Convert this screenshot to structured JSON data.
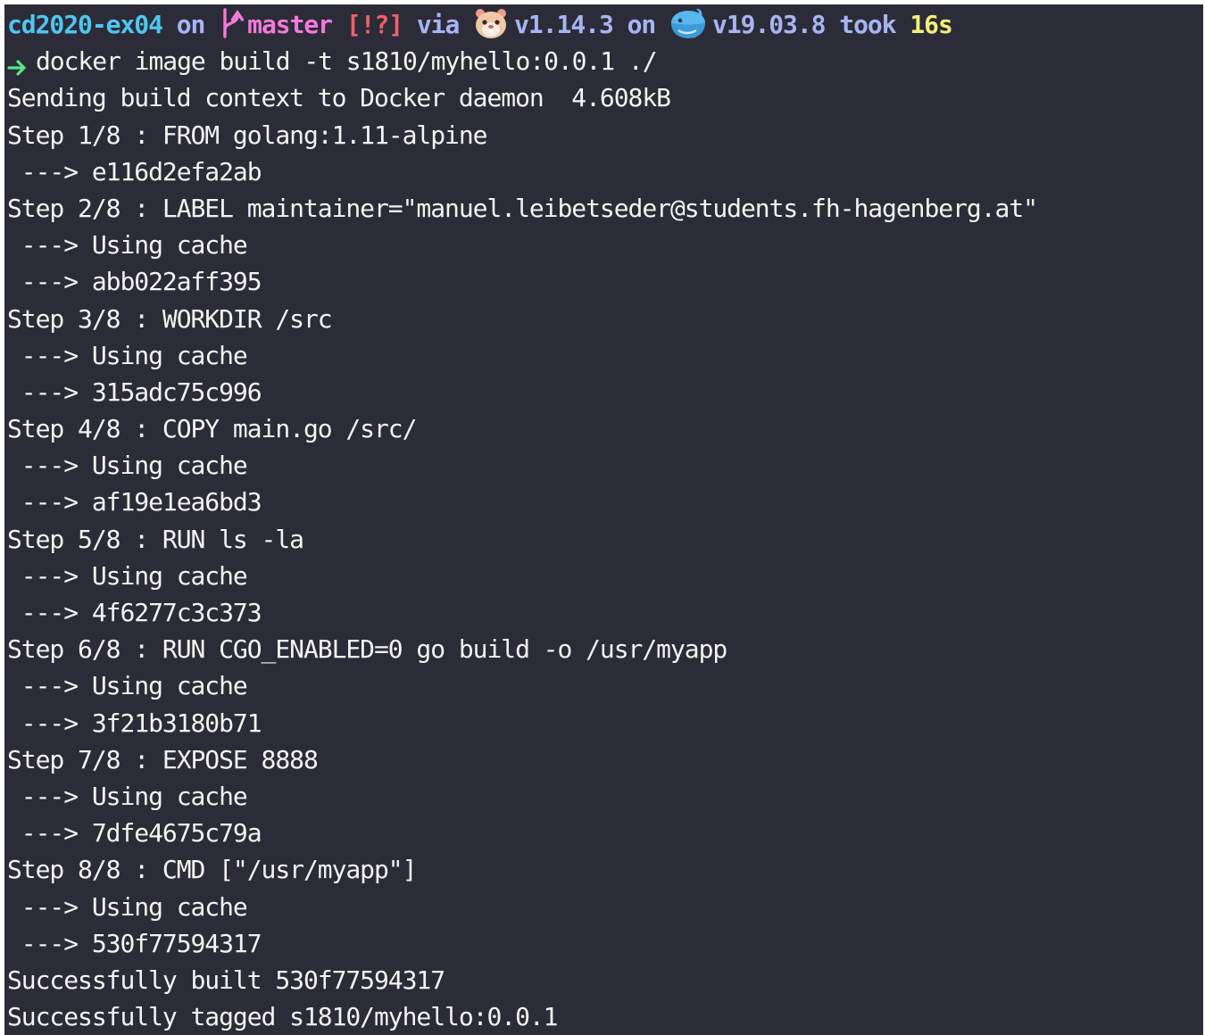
{
  "prompt": {
    "directory": "cd2020-ex04",
    "on_1": "on",
    "branch": "master",
    "git_status": "[!?]",
    "via": "via",
    "go_version": "v1.14.3",
    "on_2": "on",
    "docker_version": "v19.03.8",
    "took": "took",
    "duration": "16s",
    "icons": [
      "git-branch-icon",
      "gopher-icon",
      "docker-whale-icon",
      "prompt-arrow-icon"
    ],
    "colors": {
      "directory": "#4fc6f0",
      "keyword": "#a7b4f3",
      "branch": "#f27ad8",
      "status": "#f0606a",
      "duration": "#f3ef7a",
      "arrow": "#5ae387"
    }
  },
  "command": "docker image build -t s1810/myhello:0.0.1 ./",
  "output": [
    "Sending build context to Docker daemon  4.608kB",
    "Step 1/8 : FROM golang:1.11-alpine",
    " ---> e116d2efa2ab",
    "Step 2/8 : LABEL maintainer=\"manuel.leibetseder@students.fh-hagenberg.at\"",
    " ---> Using cache",
    " ---> abb022aff395",
    "Step 3/8 : WORKDIR /src",
    " ---> Using cache",
    " ---> 315adc75c996",
    "Step 4/8 : COPY main.go /src/",
    " ---> Using cache",
    " ---> af19e1ea6bd3",
    "Step 5/8 : RUN ls -la",
    " ---> Using cache",
    " ---> 4f6277c3c373",
    "Step 6/8 : RUN CGO_ENABLED=0 go build -o /usr/myapp",
    " ---> Using cache",
    " ---> 3f21b3180b71",
    "Step 7/8 : EXPOSE 8888",
    " ---> Using cache",
    " ---> 7dfe4675c79a",
    "Step 8/8 : CMD [\"/usr/myapp\"]",
    " ---> Using cache",
    " ---> 530f77594317",
    "Successfully built 530f77594317",
    "Successfully tagged s1810/myhello:0.0.1"
  ],
  "colors": {
    "background": "#2b2c37",
    "text": "#f3f3f3"
  }
}
